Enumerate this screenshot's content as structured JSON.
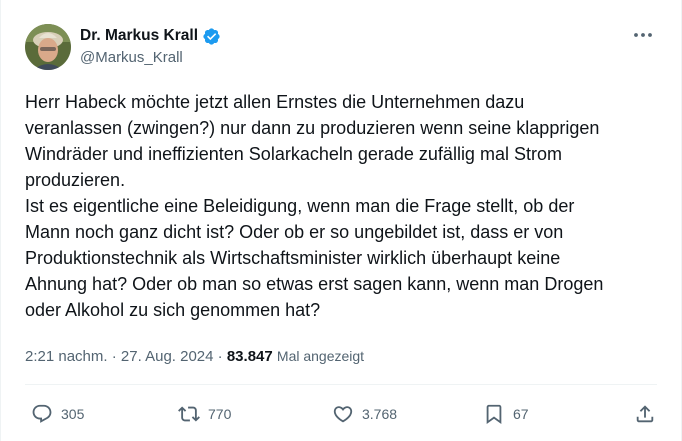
{
  "author": {
    "display_name": "Dr. Markus Krall",
    "handle": "@Markus_Krall",
    "verified": true
  },
  "tweet": {
    "text": "Herr Habeck möchte jetzt allen Ernstes die Unternehmen dazu\nveranlassen (zwingen?) nur dann zu produzieren wenn seine klapprigen\nWindräder und ineffizienten Solarkacheln gerade zufällig mal Strom\nproduzieren.\nIst es eigentliche eine Beleidigung, wenn man die Frage stellt, ob der\nMann noch ganz dicht ist? Oder ob er so ungebildet ist, dass er von\nProduktionstechnik als Wirtschaftsminister wirklich überhaupt keine\nAhnung hat? Oder ob man so etwas erst sagen kann, wenn man Drogen\noder Alkohol zu sich genommen hat?"
  },
  "meta": {
    "time": "2:21 nachm.",
    "separator": " · ",
    "date": "27. Aug. 2024",
    "separator2": " · ",
    "views_count": "83.847",
    "views_label": "Mal angezeigt"
  },
  "actions": {
    "replies": "305",
    "reposts": "770",
    "likes": "3.768",
    "bookmarks": "67"
  },
  "icons": {
    "verified": "verified-badge-icon",
    "more": "more-dots-icon",
    "reply": "reply-icon",
    "repost": "repost-icon",
    "like": "heart-icon",
    "bookmark": "bookmark-icon",
    "share": "share-icon"
  },
  "colors": {
    "text_primary": "#0f1419",
    "text_secondary": "#536471",
    "verified_blue": "#1d9bf0",
    "divider": "#eff3f4"
  }
}
